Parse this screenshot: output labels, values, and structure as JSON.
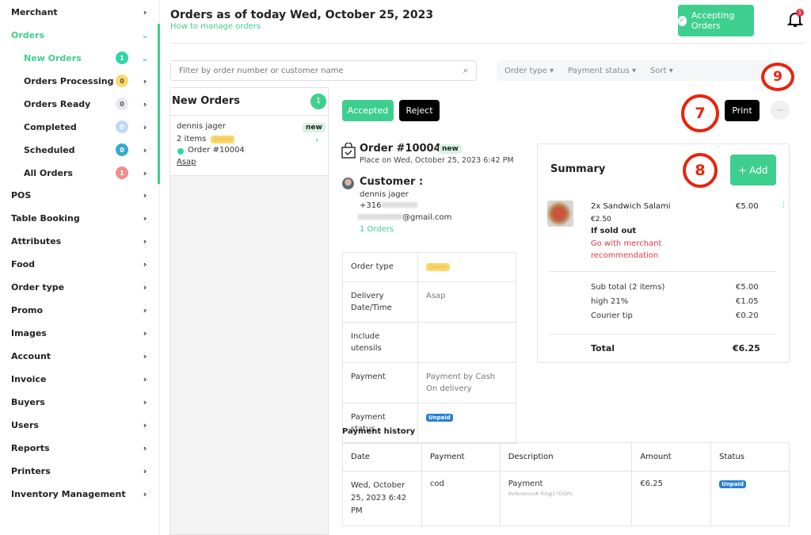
{
  "sidebar": {
    "items": [
      {
        "label": "Merchant",
        "state": "collapsed"
      },
      {
        "label": "Orders",
        "state": "expanded",
        "active": true
      },
      {
        "label": "New Orders",
        "badge": "1",
        "badge_color": "#2fd6a8",
        "active": true,
        "state": "expanded"
      },
      {
        "label": "Orders Processing",
        "badge": "0",
        "badge_color": "#fcd96a"
      },
      {
        "label": "Orders Ready",
        "badge": "0",
        "badge_color": "#ece6ef"
      },
      {
        "label": "Completed",
        "badge": "0",
        "badge_color": "#bcd9f5"
      },
      {
        "label": "Scheduled",
        "badge": "0",
        "badge_color": "#3aa9c9"
      },
      {
        "label": "All Orders",
        "badge": "1",
        "badge_color": "#ec8f8c"
      },
      {
        "label": "POS"
      },
      {
        "label": "Table Booking"
      },
      {
        "label": "Attributes"
      },
      {
        "label": "Food"
      },
      {
        "label": "Order type"
      },
      {
        "label": "Promo"
      },
      {
        "label": "Images"
      },
      {
        "label": "Account"
      },
      {
        "label": "Invoice"
      },
      {
        "label": "Buyers"
      },
      {
        "label": "Users"
      },
      {
        "label": "Reports"
      },
      {
        "label": "Printers"
      },
      {
        "label": "Inventory Management"
      }
    ]
  },
  "header": {
    "title": "Orders as of today Wed, October 25, 2023",
    "help_link": "How to manage orders",
    "accepting_label": "Accepting Orders",
    "notification_count": "1"
  },
  "filters": {
    "search_placeholder": "Filter by order number or customer name",
    "order_type": "Order type",
    "payment_status": "Payment status",
    "sort": "Sort"
  },
  "list": {
    "title": "New Orders",
    "count": "1",
    "card": {
      "name": "dennis jager",
      "tag": "new",
      "items": "2 items",
      "type": "Dinein",
      "order": "Order #10004",
      "time": "Asap"
    }
  },
  "detail": {
    "accept_label": "Accepted",
    "reject_label": "Reject",
    "print_label": "Print",
    "more_label": "···",
    "order_title": "Order #10004",
    "order_tag": "new",
    "placed": "Place on Wed, October 25, 2023 6:42 PM",
    "customer_heading": "Customer :",
    "customer_name": "dennis jager",
    "phone": "+316",
    "email": "@gmail.com",
    "orders_link": "1 Orders",
    "info_rows": [
      {
        "label": "Order type",
        "value": "Dinein",
        "kind": "tag"
      },
      {
        "label": "Delivery Date/Time",
        "value": "Asap"
      },
      {
        "label": "Include utensils",
        "value": ""
      },
      {
        "label": "Payment",
        "value": "Payment by Cash On delivery"
      },
      {
        "label": "Payment status",
        "value": "Unpaid",
        "kind": "badge"
      }
    ]
  },
  "summary": {
    "title": "Summary",
    "add_label": "+ Add",
    "item": {
      "name": "2x Sandwich Salami",
      "unit_price": "€2.50",
      "price": "€5.00",
      "sold_out_label": "If sold out",
      "sold_out_action": "Go with merchant recommendation"
    },
    "rows": [
      {
        "label": "Sub total (2 items)",
        "value": "€5.00"
      },
      {
        "label": "high 21%",
        "value": "€1.05"
      },
      {
        "label": "Courier tip",
        "value": "€0.20"
      }
    ],
    "total_label": "Total",
    "total_value": "€6.25"
  },
  "payment_history": {
    "title": "Payment history",
    "columns": [
      "Date",
      "Payment",
      "Description",
      "Amount",
      "Status"
    ],
    "row": {
      "date": "Wed, October 25, 2023 6:42 PM",
      "payment": "cod",
      "description": "Payment",
      "reference": "Reference# RXqJ17GQPv",
      "amount": "€6.25",
      "status": "Unpaid"
    }
  },
  "annotations": [
    "7",
    "8",
    "9"
  ],
  "colors": {
    "accent": "#3ecf8e",
    "danger": "#e8364a",
    "annotation": "#e8230f"
  }
}
